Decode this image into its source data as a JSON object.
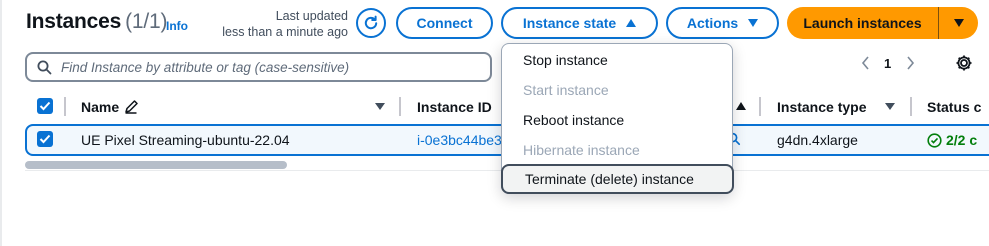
{
  "header": {
    "title": "Instances",
    "count": "(1/1)",
    "info_link": "Info",
    "last_updated_line1": "Last updated",
    "last_updated_line2": "less than a minute ago"
  },
  "toolbar": {
    "connect_label": "Connect",
    "instance_state_label": "Instance state",
    "actions_label": "Actions",
    "launch_label": "Launch instances"
  },
  "search": {
    "placeholder": "Find Instance by attribute or tag (case-sensitive)"
  },
  "pagination": {
    "current_page": "1"
  },
  "table": {
    "columns": [
      "Name",
      "Instance ID",
      "Instance type",
      "Status c"
    ],
    "rows": [
      {
        "name": "UE Pixel Streaming-ubuntu-22.04",
        "instance_id": "i-0e3bc44be3",
        "instance_type": "g4dn.4xlarge",
        "status_check": "2/2 c"
      }
    ]
  },
  "instance_state_menu": {
    "items": [
      {
        "label": "Stop instance",
        "disabled": false
      },
      {
        "label": "Start instance",
        "disabled": true
      },
      {
        "label": "Reboot instance",
        "disabled": false
      },
      {
        "label": "Hibernate instance",
        "disabled": true
      },
      {
        "label": "Terminate (delete) instance",
        "disabled": false,
        "highlighted": true
      }
    ]
  },
  "colors": {
    "accent": "#0972d3",
    "launch": "#ff9900",
    "success": "#037f0c",
    "disabled_text": "#9ba7b6"
  },
  "icons": [
    "refresh-icon",
    "caret-up-icon",
    "caret-down-icon",
    "search-icon",
    "chevron-left-icon",
    "chevron-right-icon",
    "gear-icon",
    "pencil-icon",
    "checkbox-icon",
    "sort-icon",
    "magnifier-icon",
    "status-ok-icon"
  ]
}
